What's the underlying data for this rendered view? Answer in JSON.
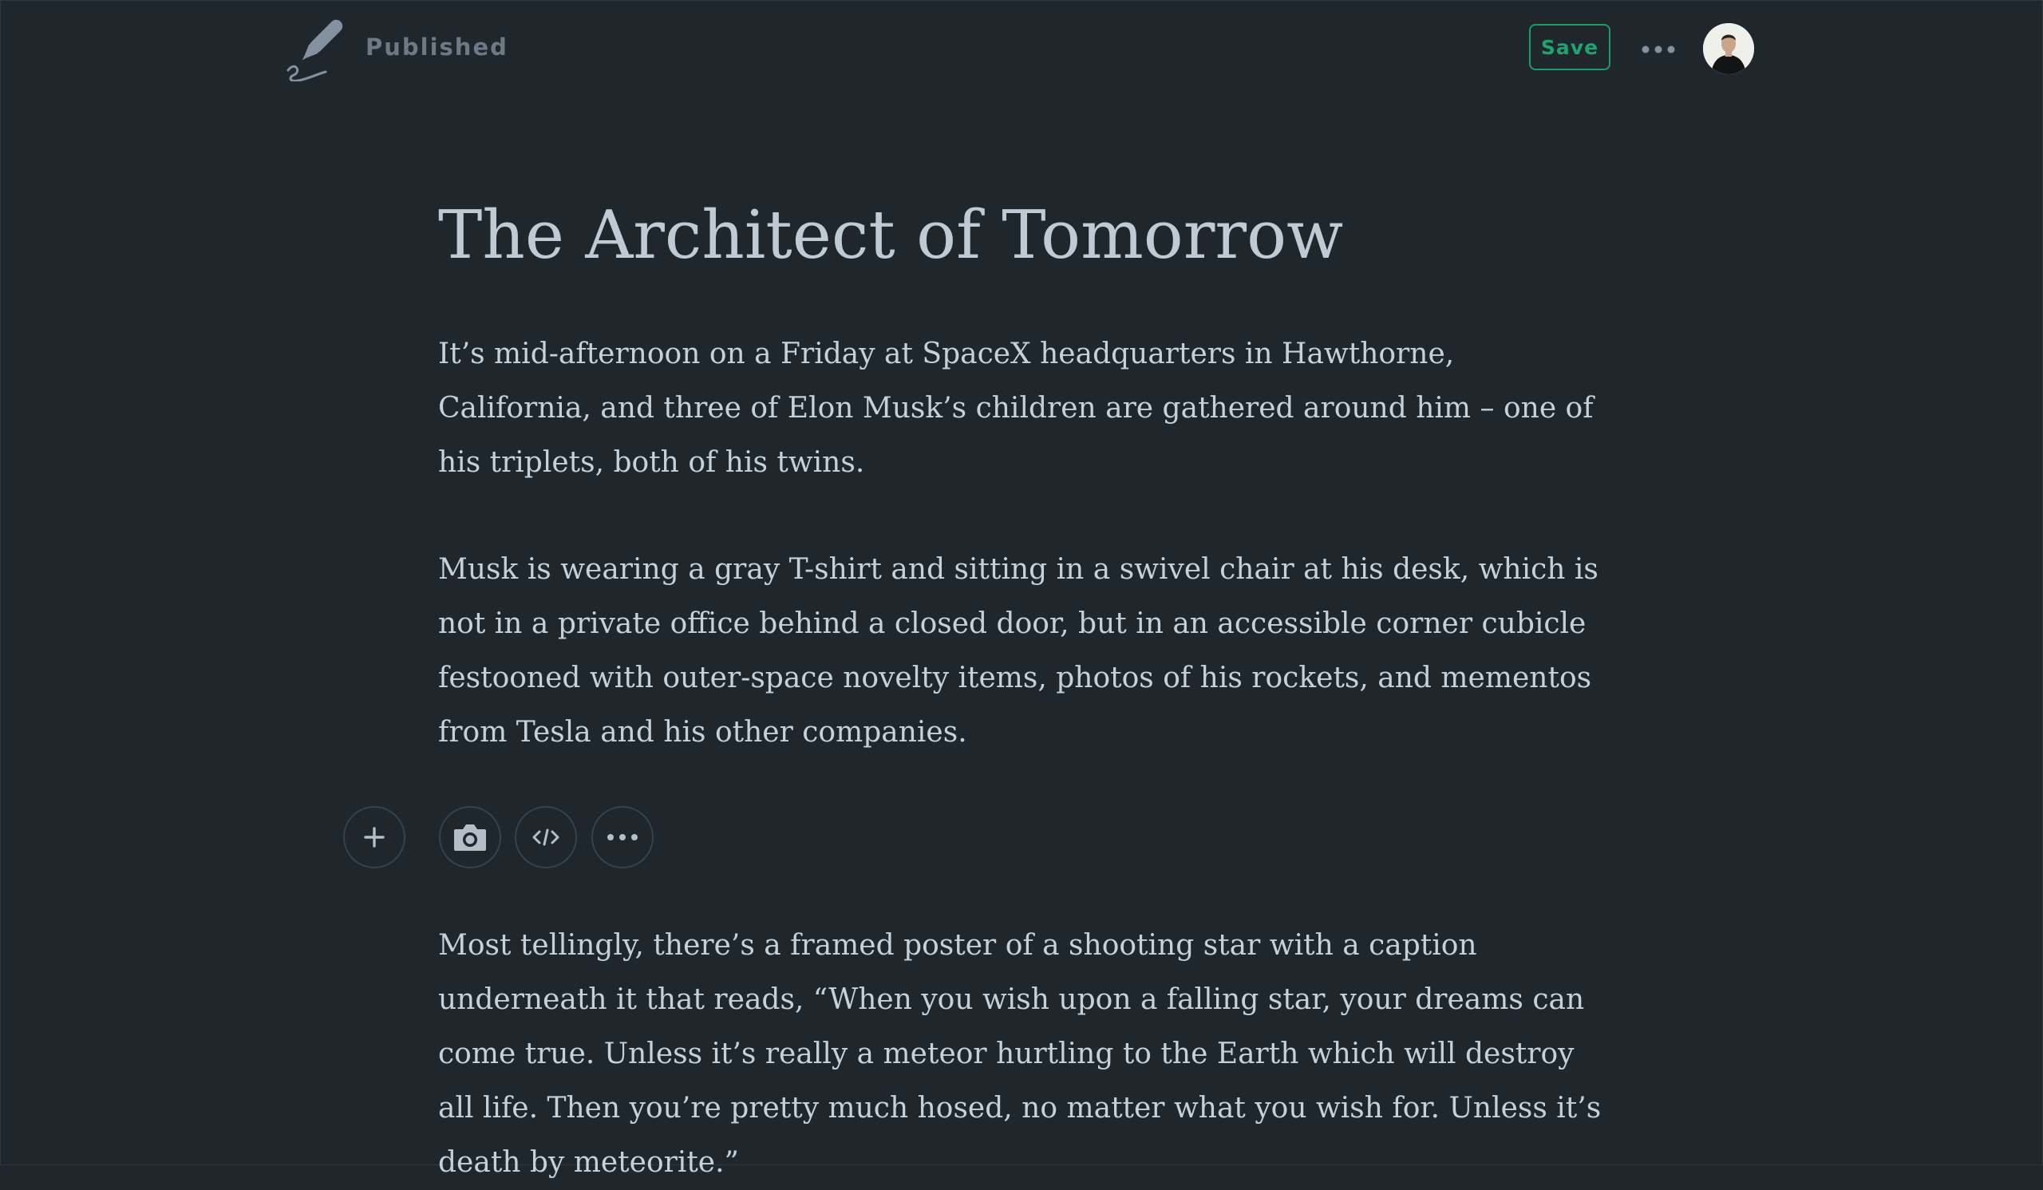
{
  "header": {
    "status": "Published",
    "save_label": "Save",
    "logo_icon": "quill-pen-icon",
    "more_icon": "more-horizontal-icon",
    "avatar_icon": "user-avatar-icon"
  },
  "article": {
    "title": "The Architect of Tomorrow",
    "paragraphs": [
      "It’s mid-afternoon on a Friday at SpaceX headquarters in Hawthorne, California, and three of Elon Musk’s children are gathered around him – one of his triplets, both of his twins.",
      "Musk is wearing a gray T-shirt and sitting in a swivel chair at his desk, which is not in a private office behind a closed door, but in an accessible corner cubicle festooned with outer-space novelty items, photos of his rockets, and mementos from Tesla and his other companies.",
      "Most tellingly, there’s a framed poster of a shooting star with a caption underneath it that reads, “When you wish upon a falling star, your dreams can come true. Unless it’s really a meteor hurtling to the Earth which will destroy all life. Then you’re pretty much hosed, no matter what you wish for. Unless it’s death by meteorite.”"
    ]
  },
  "inline_toolbar": {
    "add_icon": "plus-icon",
    "image_icon": "camera-icon",
    "embed_icon": "code-embed-icon",
    "more_icon": "more-horizontal-icon"
  },
  "colors": {
    "background": "#1f262c",
    "text": "#c6d0d9",
    "title": "#bfcad5",
    "accent": "#1fa374",
    "muted": "#6d7a86"
  }
}
